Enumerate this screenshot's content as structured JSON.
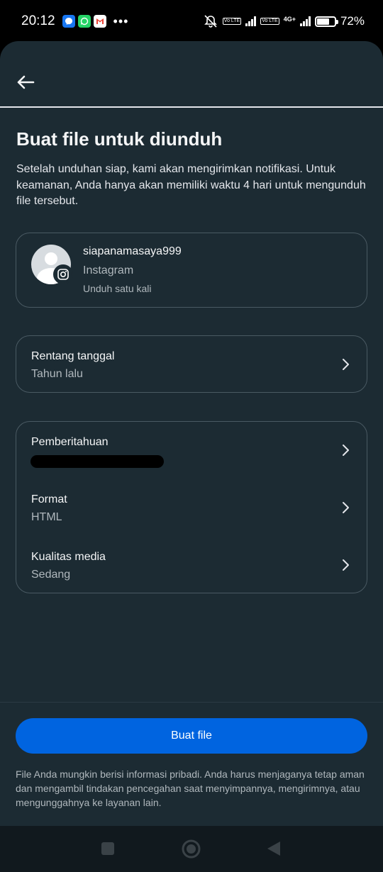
{
  "status_bar": {
    "time": "20:12",
    "app_icons": [
      "messenger-icon",
      "whatsapp-icon",
      "gmail-icon"
    ],
    "more": "•••",
    "network_1": "Vo LTE",
    "network_2": "Vo LTE",
    "network_3": "4G+",
    "battery_level": 0.72,
    "battery_label": "72%"
  },
  "header": {
    "back_icon": "arrow-left-icon"
  },
  "page": {
    "title": "Buat file untuk diunduh",
    "description": "Setelah unduhan siap, kami akan mengirimkan notifikasi. Untuk keamanan, Anda hanya akan memiliki waktu 4 hari untuk mengunduh file tersebut."
  },
  "account": {
    "username": "siapanamasaya999",
    "platform": "Instagram",
    "note": "Unduh satu kali",
    "badge_icon": "instagram-icon"
  },
  "date_range": {
    "label": "Rentang tanggal",
    "value": "Tahun lalu"
  },
  "settings": {
    "notification": {
      "label": "Pemberitahuan",
      "value": ""
    },
    "format": {
      "label": "Format",
      "value": "HTML"
    },
    "media_quality": {
      "label": "Kualitas media",
      "value": "Sedang"
    }
  },
  "footer": {
    "button_label": "Buat file",
    "disclaimer": "File Anda mungkin berisi informasi pribadi. Anda harus menjaganya tetap aman dan mengambil tindakan pencegahan saat menyimpannya, mengirimnya, atau mengunggahnya ke layanan lain."
  },
  "nav": {
    "icons": [
      "recents-icon",
      "home-icon",
      "back-triangle-icon"
    ]
  },
  "colors": {
    "background": "#1c2b33",
    "primary": "#0064e0",
    "text": "#e4e6eb",
    "secondary_text": "#b0b8bd",
    "border": "#4a5a63"
  }
}
